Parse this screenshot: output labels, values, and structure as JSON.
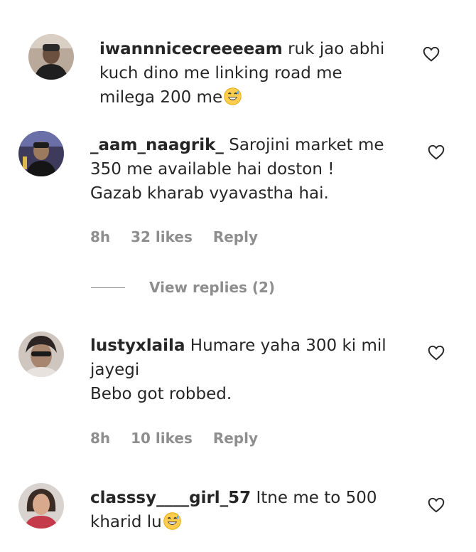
{
  "comments": [
    {
      "username": "iwannnicecreeeeam",
      "text": "ruk jao abhi\nkuch dino me linking road me\nmilega 200 me",
      "emoji": "grinning-sweat-emoji"
    },
    {
      "username": "_aam_naagrik_",
      "text": "Sarojini market me\n350 me available hai doston !\nGazab kharab vyavastha hai.",
      "time": "8h",
      "likes": "32 likes",
      "reply": "Reply",
      "view_replies": "View replies (2)"
    },
    {
      "username": "lustyxlaila",
      "text": "Humare yaha 300 ki mil\njayegi\nBebo got robbed.",
      "time": "8h",
      "likes": "10 likes",
      "reply": "Reply"
    },
    {
      "username": "classsy____girl_57",
      "text": "Itne me to 500\nkharid lu",
      "emoji": "grinning-sweat-emoji"
    }
  ],
  "icons": {
    "like": "heart-outline-icon"
  },
  "colors": {
    "text": "#262626",
    "meta": "#8e8e8e"
  }
}
